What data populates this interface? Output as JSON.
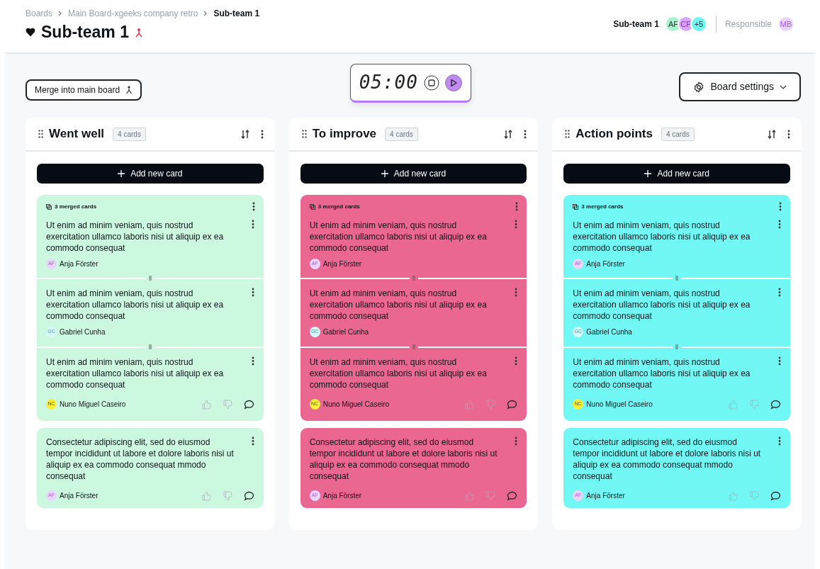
{
  "breadcrumbs": [
    {
      "label": "Boards",
      "current": false
    },
    {
      "label": "Main Board-xgeeks company retro",
      "current": false
    },
    {
      "label": "Sub-team 1",
      "current": true
    }
  ],
  "title": "Sub-team 1",
  "team": {
    "label": "Sub-team 1",
    "members": [
      {
        "initials": "AF",
        "color": "#a7f3d0"
      },
      {
        "initials": "CP",
        "color": "#d8a6ff"
      },
      {
        "initials": "+5",
        "color": "#6ff6f1"
      }
    ],
    "responsible_label": "Responsible",
    "responsible": {
      "initials": "MB",
      "color": "#ead5ff"
    }
  },
  "merge_button": "Merge into main board",
  "timer": {
    "time": "05:00"
  },
  "settings_button": "Board settings",
  "columns": [
    {
      "title": "Went well",
      "count": "4 cards",
      "color": "#cdf8e0",
      "add_label": "Add new card",
      "cards": [
        {
          "kind": "merged",
          "merged_label": "3 merged cards",
          "items": [
            {
              "text": "Ut enim ad minim veniam, quis nostrud exercitation ullamco laboris nisi ut aliquip ex ea commodo consequat",
              "author": "Anja Förster",
              "initials": "AF",
              "color": "#ead5ff"
            },
            {
              "text": "Ut enim ad minim veniam, quis nostrud exercitation ullamco laboris nisi ut aliquip ex ea commodo consequat",
              "author": "Gabriel Cunha",
              "initials": "GC",
              "color": "#d5f8fb"
            },
            {
              "text": "Ut enim ad minim veniam, quis nostrud exercitation ullamco laboris nisi ut aliquip ex ea commodo consequat",
              "author": "Nuno Miguel Caseiro",
              "initials": "NC",
              "color": "#f8f03a"
            }
          ]
        },
        {
          "kind": "single",
          "text": "Consectetur adipiscing elit, sed do eiusmod tempor incididunt ut labore et dolore laboris nisi ut aliquip ex ea commodo consequat mmodo consequat",
          "author": "Anja Förster",
          "initials": "AF",
          "color": "#ead5ff"
        }
      ]
    },
    {
      "title": "To improve",
      "count": "4 cards",
      "color": "#ea6792",
      "add_label": "Add new card",
      "cards": [
        {
          "kind": "merged",
          "merged_label": "3 merged cards",
          "items": [
            {
              "text": "Ut enim ad minim veniam, quis nostrud exercitation ullamco laboris nisi ut aliquip ex ea commodo consequat",
              "author": "Anja Förster",
              "initials": "AF",
              "color": "#ead5ff"
            },
            {
              "text": "Ut enim ad minim veniam, quis nostrud exercitation ullamco laboris nisi ut aliquip ex ea commodo consequat",
              "author": "Gabriel Cunha",
              "initials": "GC",
              "color": "#d5f8fb"
            },
            {
              "text": "Ut enim ad minim veniam, quis nostrud exercitation ullamco laboris nisi ut aliquip ex ea commodo consequat",
              "author": "Nuno Miguel Caseiro",
              "initials": "NC",
              "color": "#f8f03a"
            }
          ]
        },
        {
          "kind": "single",
          "text": "Consectetur adipiscing elit, sed do eiusmod tempor incididunt ut labore et dolore laboris nisi ut aliquip ex ea commodo consequat mmodo consequat",
          "author": "Anja Förster",
          "initials": "AF",
          "color": "#ead5ff"
        }
      ]
    },
    {
      "title": "Action points",
      "count": "4 cards",
      "color": "#72f8f4",
      "add_label": "Add new card",
      "cards": [
        {
          "kind": "merged",
          "merged_label": "3 merged cards",
          "items": [
            {
              "text": "Ut enim ad minim veniam, quis nostrud exercitation ullamco laboris nisi ut aliquip ex ea commodo consequat",
              "author": "Anja Förster",
              "initials": "AF",
              "color": "#ead5ff"
            },
            {
              "text": "Ut enim ad minim veniam, quis nostrud exercitation ullamco laboris nisi ut aliquip ex ea commodo consequat",
              "author": "Gabriel Cunha",
              "initials": "GC",
              "color": "#d5f8fb"
            },
            {
              "text": "Ut enim ad minim veniam, quis nostrud exercitation ullamco laboris nisi ut aliquip ex ea commodo consequat",
              "author": "Nuno Miguel Caseiro",
              "initials": "NC",
              "color": "#f8f03a"
            }
          ]
        },
        {
          "kind": "single",
          "text": "Consectetur adipiscing elit, sed do eiusmod tempor incididunt ut labore et dolore laboris nisi ut aliquip ex ea commodo consequat mmodo consequat",
          "author": "Anja Förster",
          "initials": "AF",
          "color": "#ead5ff"
        }
      ]
    }
  ]
}
